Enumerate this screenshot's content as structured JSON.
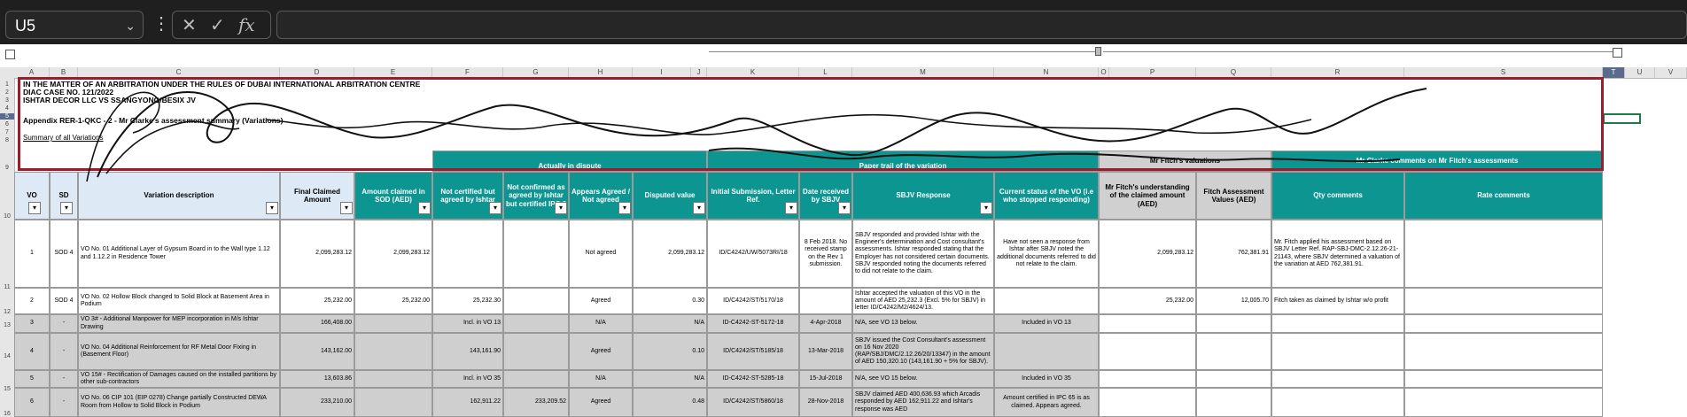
{
  "toolbar": {
    "name_box": "U5",
    "cancel_glyph": "✕",
    "enter_glyph": "✓",
    "fx_glyph": "fx",
    "formula_value": ""
  },
  "columns": [
    "A",
    "B",
    "C",
    "D",
    "E",
    "F",
    "G",
    "H",
    "I",
    "J",
    "K",
    "L",
    "M",
    "N",
    "O",
    "P",
    "Q",
    "R",
    "S",
    "T",
    "U",
    "V"
  ],
  "rows": [
    "1",
    "2",
    "3",
    "4",
    "5",
    "6",
    "7",
    "8",
    "9",
    "10",
    "11",
    "12",
    "13",
    "14",
    "15",
    "16"
  ],
  "titles": {
    "line1": "IN THE MATTER OF AN ARBITRATION UNDER THE RULES OF DUBAI INTERNATIONAL ARBITRATION CENTRE",
    "line2": "DIAC CASE NO. 121/2022",
    "line3": "ISHTAR DECOR LLC VS SSANGYONG/BESIX JV",
    "line4": "Appendix RER-1-QKC - 2 - Mr Clarke's assessment summary (Variations)",
    "line5": "Summary of all Variations"
  },
  "groups": {
    "actually_in_dispute": "Actually in dispute",
    "paper_trail": "Paper trail of the variation",
    "fitch_valuations": "Mr Fitch's valuations",
    "clarke_comments": "Mr Clarke comments on Mr Fitch's assessments"
  },
  "headers": {
    "vo": "VO",
    "sd": "SD",
    "desc": "Variation description",
    "final": "Final Claimed Amount",
    "sod": "Amount claimed in SOD (AED)",
    "not_certified": "Not certified but agreed by Ishtar",
    "not_confirmed": "Not confirmed as agreed by Ishtar but certified IPC 6",
    "appears_agreed": "Appears Agreed / Not agreed",
    "disputed": "Disputed value",
    "initial_sub": "Initial Submission, Letter Ref.",
    "date_received": "Date received by SBJV",
    "sbjv_response": "SBJV Response",
    "current_status": "Current status of the VO (i.e who stopped responding)",
    "fitch_understanding": "Mr Fitch's understanding of the claimed amount (AED)",
    "fitch_values": "Fitch Assessment Values (AED)",
    "qty_comments": "Qty comments",
    "rate_comments": "Rate comments"
  },
  "rows_data": [
    {
      "vo": "1",
      "sd": "SOD 4",
      "desc": "VO No. 01 Additional Layer of Gypsum Board in to the Wall type 1.12 and 1.12.2 in Residence Tower",
      "final": "2,099,283.12",
      "sod": "2,099,283.12",
      "nc": "",
      "ncf": "",
      "agreed": "Not agreed",
      "disputed": "2,099,283.12",
      "ref": "ID/C4242/UW/5073RI/18",
      "date": "8 Feb 2018. No received stamp on the Rev 1 submission.",
      "resp": "SBJV responded and provided Ishtar with the Engineer's determination and Cost consultant's assessments. Ishtar responded stating that the Employer has not considered certain documents. SBJV responded noting the documents referred to did not relate to the claim.",
      "status": "Have not seen a response from Ishtar after SBJV noted the additional documents referred to did not relate to the claim.",
      "fu": "2,099,283.12",
      "fv": "762,381.91",
      "qty": "Mr. Fitch applied his assessment based on SBJV Letter Ref. RAP-SBJ-DMC-2.12.26-21-21143, where SBJV determined a valuation of the variation at AED 762,381.91.",
      "rate": ""
    },
    {
      "vo": "2",
      "sd": "SOD 4",
      "desc": "VO No. 02 Hollow Block changed to Solid Block at Basement Area in Podium",
      "final": "25,232.00",
      "sod": "25,232.00",
      "nc": "25,232.30",
      "ncf": "",
      "agreed": "Agreed",
      "disputed": "0.30",
      "ref": "ID/C4242/ST/5170/18",
      "date": "",
      "resp": "Ishtar accepted the valuation of this VO in the amount of AED 25,232.3 (Excl. 5% for SBJV) in letter ID/C4242/M2/4624/13.",
      "status": "",
      "fu": "25,232.00",
      "fv": "12,005.70",
      "qty": "Fitch taken as claimed by Ishtar w/o profit",
      "rate": ""
    },
    {
      "vo": "3",
      "sd": "-",
      "desc": "VO 3# - Additional Manpower for MEP incorporation in M/s Ishtar Drawing",
      "final": "166,408.00",
      "sod": "",
      "nc": "Incl. in VO 13",
      "ncf": "",
      "agreed": "N/A",
      "disputed": "N/A",
      "ref": "ID-C4242-ST-5172-18",
      "date": "4-Apr-2018",
      "resp": "N/A, see VO 13 below.",
      "status": "Included in VO 13",
      "fu": "",
      "fv": "",
      "qty": "",
      "rate": ""
    },
    {
      "vo": "4",
      "sd": "-",
      "desc": "VO No. 04 Additional Reinforcement for RF Metal Door Fixing in      (Basement Floor)",
      "final": "143,162.00",
      "sod": "",
      "nc": "143,161.90",
      "ncf": "",
      "agreed": "Agreed",
      "disputed": "0.10",
      "ref": "ID/C4242/ST/5185/18",
      "date": "13-Mar-2018",
      "resp": "SBJV issued the Cost Consultant's assessment on 16 Nov 2020 (RAP/SBJ/DMC/2.12.26/20/13347) in the amount of AED 150,320.10 (143,161.90 + 5% for SBJV).",
      "status": "",
      "fu": "",
      "fv": "",
      "qty": "",
      "rate": ""
    },
    {
      "vo": "5",
      "sd": "-",
      "desc": "VO 15# - Rectification of Damages caused on the installed partitions by other sub-contractors",
      "final": "13,603.86",
      "sod": "",
      "nc": "Incl. in VO 35",
      "ncf": "",
      "agreed": "N/A",
      "disputed": "N/A",
      "ref": "ID-C4242-ST-5285-18",
      "date": "15-Jul-2018",
      "resp": "N/A, see VO 15 below.",
      "status": "Included in VO 35",
      "fu": "",
      "fv": "",
      "qty": "",
      "rate": ""
    },
    {
      "vo": "6",
      "sd": "-",
      "desc": "VO No. 06 CIP 101 (EIP 0278) Change partially Constructed DEWA Room from Hollow to Solid Block in Podium",
      "final": "233,210.00",
      "sod": "",
      "nc": "162,911.22",
      "ncf": "233,209.52",
      "agreed": "Agreed",
      "disputed": "0.48",
      "ref": "ID/C4242/ST/5860/18",
      "date": "28-Nov-2018",
      "resp": "SBJV claimed AED 400,636.93 which Arcadis responded by AED 162,911.22 and Ishtar's response was AED",
      "status": "Amount certified in IPC 65 is as claimed. Appears agreed.",
      "fu": "",
      "fv": "",
      "qty": "",
      "rate": ""
    }
  ]
}
